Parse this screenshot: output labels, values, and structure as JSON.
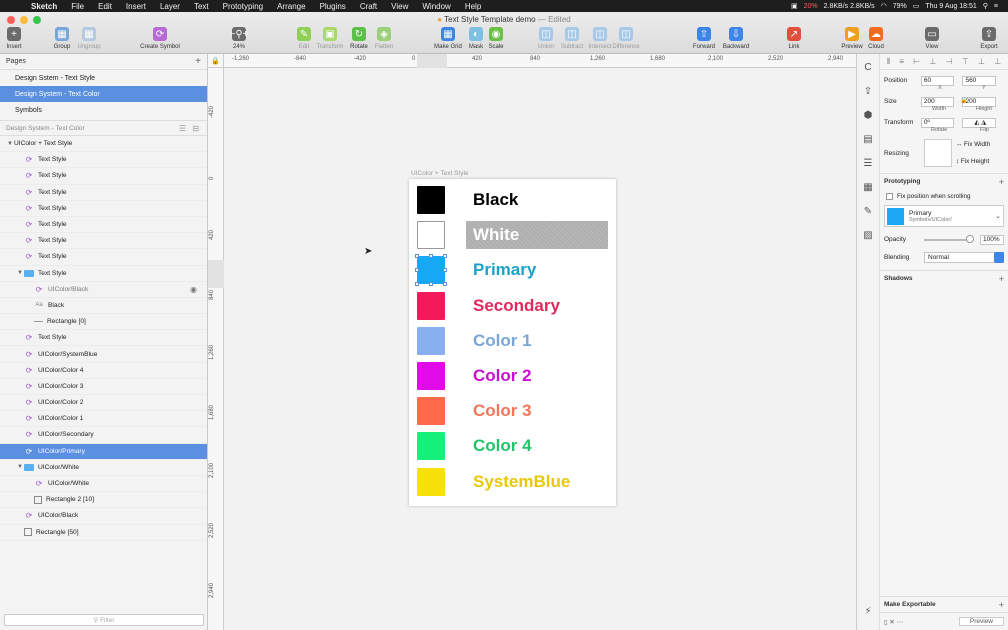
{
  "menubar": {
    "app": "Sketch",
    "items": [
      "File",
      "Edit",
      "Insert",
      "Layer",
      "Text",
      "Prototyping",
      "Arrange",
      "Plugins",
      "Craft",
      "View",
      "Window",
      "Help"
    ],
    "network": "2.8KB/s 2.8KB/s",
    "battery_percent": "20%",
    "battery_main": "79%",
    "datetime": "Thu 9 Aug 18:51"
  },
  "window": {
    "title": "Text Style Template demo",
    "edited": "— Edited"
  },
  "toolbar": {
    "items": [
      {
        "label": "Insert",
        "icon": "+",
        "color": "#6b6b6b"
      },
      {
        "label": "Group",
        "icon": "▦",
        "color": "#7aa6d8"
      },
      {
        "label": "Ungroup",
        "icon": "▦",
        "color": "#b5c9e0"
      },
      {
        "label": "Create Symbol",
        "icon": "⟳",
        "color": "#b56ad6"
      },
      {
        "label": "24%",
        "icon": "−⚲+",
        "color": "#6b6b6b"
      },
      {
        "label": "Edit",
        "icon": "✎",
        "color": "#8fcf5a"
      },
      {
        "label": "Transform",
        "icon": "▣",
        "color": "#a8d86a"
      },
      {
        "label": "Rotate",
        "icon": "↻",
        "color": "#5bbf4a"
      },
      {
        "label": "Flatten",
        "icon": "◈",
        "color": "#9ad07a"
      },
      {
        "label": "Make Grid",
        "icon": "▦",
        "color": "#3d85e6"
      },
      {
        "label": "Mask",
        "icon": "◐",
        "color": "#7fc0e0"
      },
      {
        "label": "Scale",
        "icon": "◉",
        "color": "#6cc04a"
      },
      {
        "label": "Union",
        "icon": "◫",
        "color": "#a8c8e8"
      },
      {
        "label": "Subtract",
        "icon": "◫",
        "color": "#a8c8e8"
      },
      {
        "label": "Intersect",
        "icon": "◫",
        "color": "#a8c8e8"
      },
      {
        "label": "Difference",
        "icon": "◫",
        "color": "#a8c8e8"
      },
      {
        "label": "Forward",
        "icon": "⇧",
        "color": "#3d85e6"
      },
      {
        "label": "Backward",
        "icon": "⇩",
        "color": "#3d85e6"
      },
      {
        "label": "Link",
        "icon": "↗",
        "color": "#e0503d"
      },
      {
        "label": "Preview",
        "icon": "▶",
        "color": "#f0a020"
      },
      {
        "label": "Cloud",
        "icon": "☁",
        "color": "#f06a20"
      },
      {
        "label": "View",
        "icon": "▭",
        "color": "#6b6b6b"
      },
      {
        "label": "Export",
        "icon": "⇪",
        "color": "#6b6b6b"
      }
    ]
  },
  "pages": {
    "header": "Pages",
    "items": [
      {
        "label": "Design Sstem - Text Style",
        "selected": false
      },
      {
        "label": "Design System - Text Color",
        "selected": true
      },
      {
        "label": "Symbols",
        "selected": false
      }
    ]
  },
  "layers": {
    "header": "Design System - Text Color",
    "items": [
      {
        "label": "UIColor + Text Style",
        "type": "artboard",
        "indent": 0,
        "tri": "▼"
      },
      {
        "label": "Text Style",
        "type": "sym",
        "indent": 1
      },
      {
        "label": "Text Style",
        "type": "sym",
        "indent": 1
      },
      {
        "label": "Text Style",
        "type": "sym",
        "indent": 1
      },
      {
        "label": "Text Style",
        "type": "sym",
        "indent": 1
      },
      {
        "label": "Text Style",
        "type": "sym",
        "indent": 1
      },
      {
        "label": "Text Style",
        "type": "sym",
        "indent": 1
      },
      {
        "label": "Text Style",
        "type": "sym",
        "indent": 1
      },
      {
        "label": "Text Style",
        "type": "folder",
        "indent": 1,
        "tri": "▼"
      },
      {
        "label": "UIColor/Black",
        "type": "sym",
        "indent": 2,
        "dim": true,
        "eye": true
      },
      {
        "label": "Black",
        "type": "text",
        "indent": 2
      },
      {
        "label": "Rectangle [0]",
        "type": "line",
        "indent": 2
      },
      {
        "label": "Text Style",
        "type": "sym",
        "indent": 1
      },
      {
        "label": "UIColor/SystemBlue",
        "type": "sym",
        "indent": 1
      },
      {
        "label": "UIColor/Color 4",
        "type": "sym",
        "indent": 1
      },
      {
        "label": "UIColor/Color 3",
        "type": "sym",
        "indent": 1
      },
      {
        "label": "UIColor/Color 2",
        "type": "sym",
        "indent": 1
      },
      {
        "label": "UIColor/Color 1",
        "type": "sym",
        "indent": 1
      },
      {
        "label": "UIColor/Secondary",
        "type": "sym",
        "indent": 1
      },
      {
        "label": "UIColor/Primary",
        "type": "sym",
        "indent": 1,
        "selected": true
      },
      {
        "label": "UIColor/White",
        "type": "folder",
        "indent": 1,
        "tri": "▼"
      },
      {
        "label": "UIColor/White",
        "type": "sym",
        "indent": 2
      },
      {
        "label": "Rectangle 2 [10]",
        "type": "rect",
        "indent": 2
      },
      {
        "label": "UIColor/Black",
        "type": "sym",
        "indent": 1
      },
      {
        "label": "Rectangle [50]",
        "type": "rect",
        "indent": 1
      }
    ],
    "filter_placeholder": "Filter"
  },
  "rulers": {
    "h": [
      "-1,260",
      "-840",
      "-420",
      "0",
      "420",
      "840",
      "1,260",
      "1,680",
      "2,100",
      "2,520",
      "2,940"
    ],
    "v": [
      "-420",
      "0",
      "420",
      "840",
      "1,260",
      "1,680",
      "2,100",
      "2,520",
      "2,940"
    ]
  },
  "artboard": {
    "label": "UIColor + Text Style",
    "swatches": [
      {
        "name": "Black",
        "color": "#000000",
        "text_color": "#000000"
      },
      {
        "name": "White",
        "color": "#ffffff",
        "text_color": "#ffffff"
      },
      {
        "name": "Primary",
        "color": "#17a8f5",
        "text_color": "#1aa3c8"
      },
      {
        "name": "Secondary",
        "color": "#f31a5b",
        "text_color": "#e3295c"
      },
      {
        "name": "Color 1",
        "color": "#88b0ee",
        "text_color": "#7aa6d8"
      },
      {
        "name": "Color 2",
        "color": "#e10ae8",
        "text_color": "#c90fcf"
      },
      {
        "name": "Color 3",
        "color": "#ff6a4a",
        "text_color": "#f0775a"
      },
      {
        "name": "Color 4",
        "color": "#15f07a",
        "text_color": "#22c46a"
      },
      {
        "name": "SystemBlue",
        "color": "#f8e10a",
        "text_color": "#e8c80a"
      }
    ]
  },
  "inspector": {
    "position": {
      "label": "Position",
      "x": "60",
      "y": "560",
      "x_label": "X",
      "y_label": "Y"
    },
    "size": {
      "label": "Size",
      "w": "200",
      "h": "200",
      "w_label": "Width",
      "h_label": "Height"
    },
    "transform": {
      "label": "Transform",
      "rotate": "0º",
      "rotate_label": "Rotate",
      "flip_label": "Flip"
    },
    "resizing": {
      "label": "Resizing",
      "fix_width": "Fix Width",
      "fix_height": "Fix Height"
    },
    "prototyping": {
      "label": "Prototyping",
      "fix_scroll": "Fix position when scrolling"
    },
    "style": {
      "name": "Primary",
      "path": "Symbols/UIColor/"
    },
    "opacity": {
      "label": "Opacity",
      "value": "100%"
    },
    "blending": {
      "label": "Blending",
      "value": "Normal"
    },
    "shadows": "Shadows",
    "export": {
      "label": "Make Exportable",
      "preview": "Preview"
    }
  }
}
